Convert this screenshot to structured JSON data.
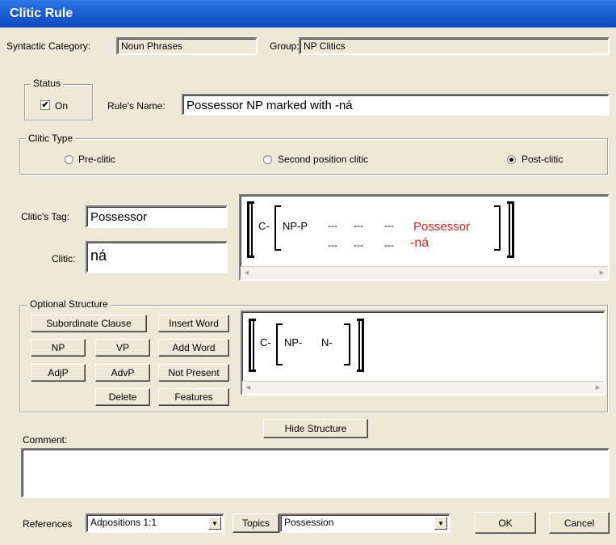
{
  "window": {
    "title": "Clitic Rule"
  },
  "header": {
    "syntactic_category_label": "Syntactic Category:",
    "syntactic_category_value": "Noun Phrases",
    "group_label": "Group:",
    "group_value": "NP Clitics"
  },
  "status": {
    "legend": "Status",
    "on_label": "On",
    "on_checked": true,
    "check_glyph": "✔"
  },
  "rule_name": {
    "label": "Rule's Name:",
    "value": "Possessor NP marked with -ná"
  },
  "clitic_type": {
    "legend": "Clitic Type",
    "options": [
      "Pre-clitic",
      "Second position clitic",
      "Post-clitic"
    ],
    "selected": "Post-clitic"
  },
  "clitic_tag": {
    "label": "Clitic's Tag:",
    "value": "Possessor"
  },
  "clitic": {
    "label": "Clitic:",
    "value": "ná"
  },
  "structure_preview": {
    "outer_label": "C-",
    "inner_label": "NP-P",
    "dashes_row1": [
      "---",
      "---",
      "---"
    ],
    "dashes_row2": [
      "---",
      "---",
      "---"
    ],
    "possessor_text": "Possessor",
    "clitic_text": "-ná",
    "highlight_color": "#e02020"
  },
  "optional_structure": {
    "legend": "Optional Structure",
    "buttons": {
      "subordinate_clause": "Subordinate Clause",
      "insert_word": "Insert Word",
      "np": "NP",
      "vp": "VP",
      "add_word": "Add Word",
      "adjp": "AdjP",
      "advp": "AdvP",
      "not_present": "Not Present",
      "delete": "Delete",
      "features": "Features"
    },
    "preview": {
      "outer_label": "C-",
      "inner_np": "NP-",
      "inner_n": "N-"
    }
  },
  "hide_structure_button": "Hide Structure",
  "comment": {
    "label": "Comment:",
    "value": ""
  },
  "footer": {
    "references_label": "References",
    "references_value": "Adpositions 1:1",
    "topics_button": "Topics",
    "topics_value": "Possession",
    "ok_button": "OK",
    "cancel_button": "Cancel"
  },
  "icons": {
    "scroll_left": "◄",
    "scroll_right": "►",
    "dropdown": "▼"
  }
}
